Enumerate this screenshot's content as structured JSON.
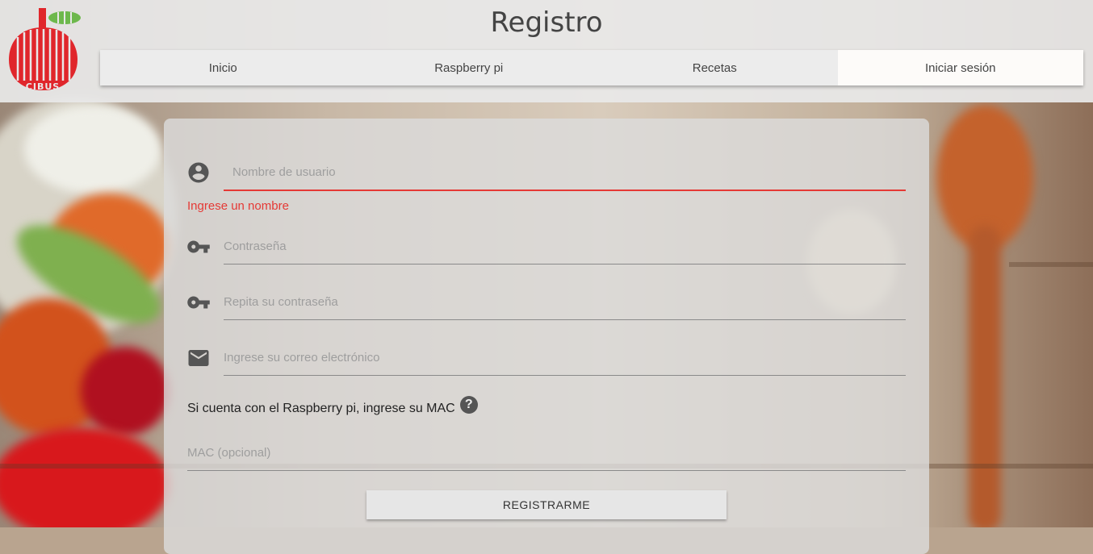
{
  "header": {
    "title": "Registro",
    "logo_text": "CIBUS",
    "nav": [
      {
        "label": "Inicio"
      },
      {
        "label": "Raspberry pi"
      },
      {
        "label": "Recetas"
      },
      {
        "label": "Iniciar sesión",
        "active": true
      }
    ]
  },
  "form": {
    "username": {
      "placeholder": "Nombre de usuario",
      "icon": "account-circle-icon",
      "error": "Ingrese un nombre"
    },
    "password": {
      "placeholder": "Contraseña",
      "icon": "key-icon"
    },
    "password_repeat": {
      "placeholder": "Repita su contraseña",
      "icon": "key-icon"
    },
    "email": {
      "placeholder": "Ingrese su correo electrónico",
      "icon": "mail-icon"
    },
    "mac_label": "Si cuenta con el Raspberry pi, ingrese su MAC",
    "mac_help_icon": "help-icon",
    "mac": {
      "placeholder": "MAC (opcional)"
    },
    "submit_label": "REGISTRARME"
  },
  "colors": {
    "error": "#e53935",
    "brand_red": "#e0262b",
    "brand_green": "#6db84c"
  }
}
